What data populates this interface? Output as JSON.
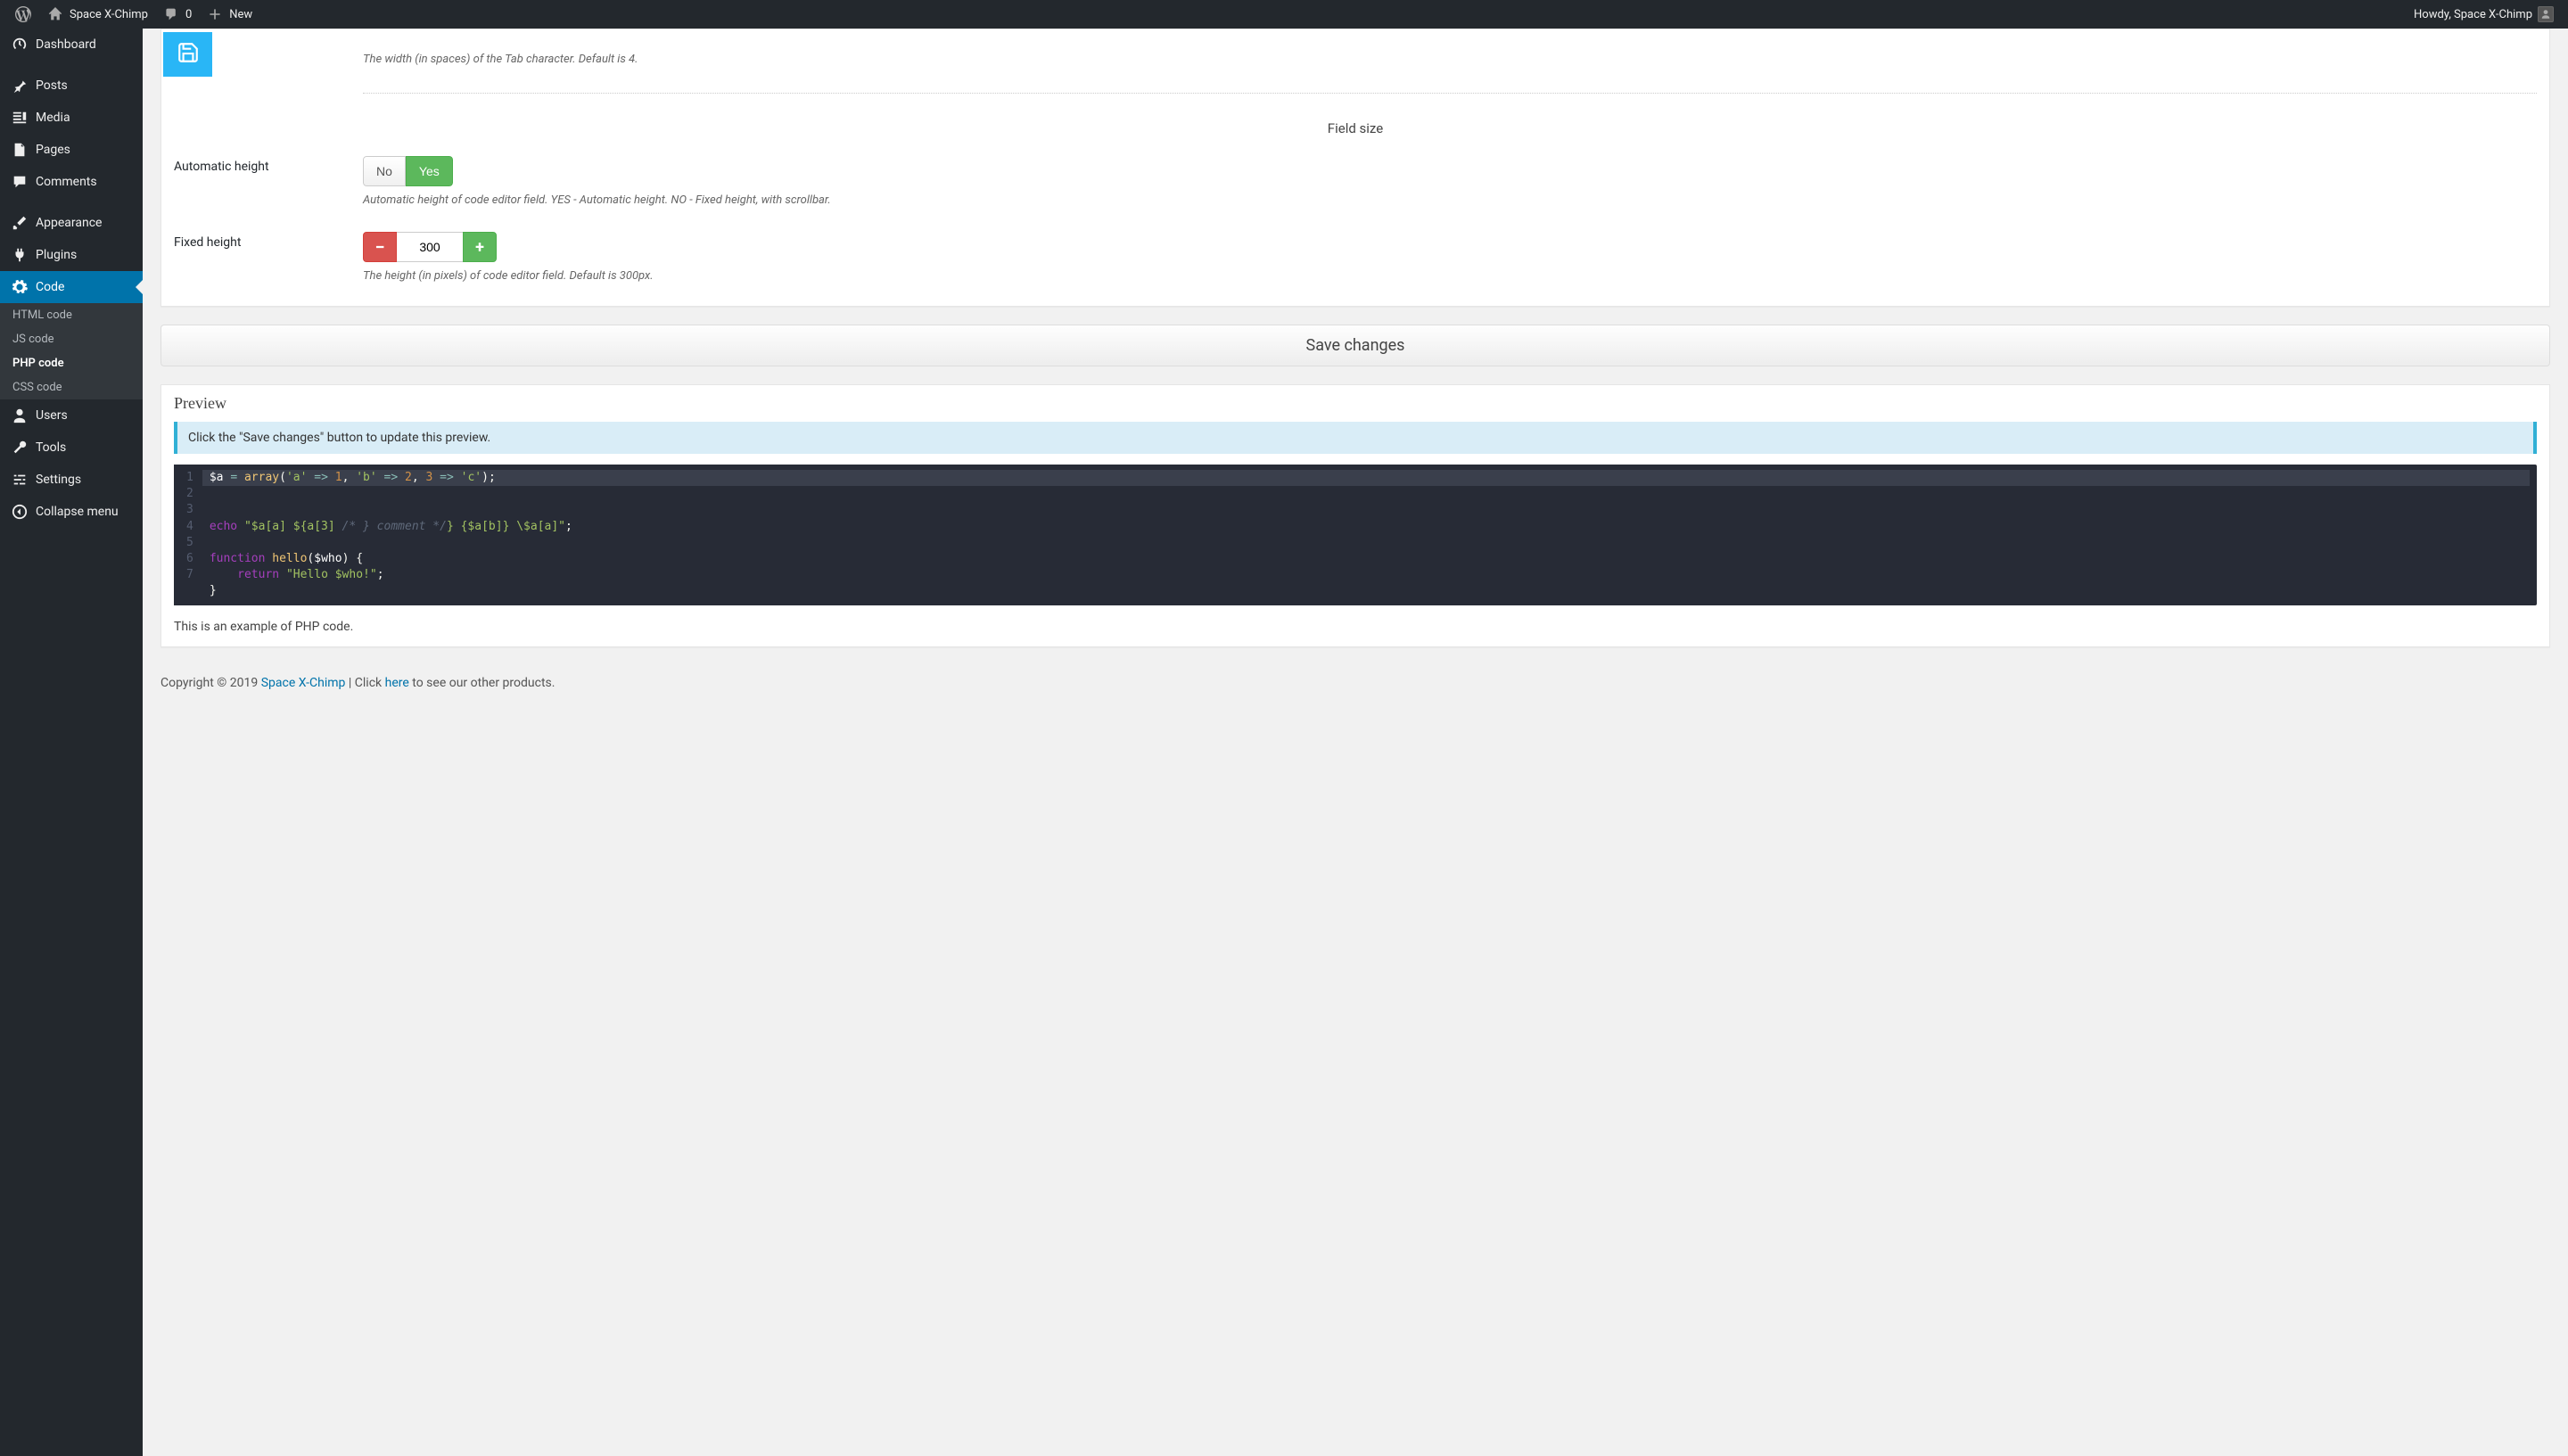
{
  "adminBar": {
    "siteName": "Space X-Chimp",
    "commentCount": "0",
    "newLabel": "New",
    "howdy": "Howdy, Space X-Chimp"
  },
  "sidebar": {
    "dashboard": "Dashboard",
    "posts": "Posts",
    "media": "Media",
    "pages": "Pages",
    "comments": "Comments",
    "appearance": "Appearance",
    "plugins": "Plugins",
    "code": "Code",
    "codeSub": {
      "html": "HTML code",
      "js": "JS code",
      "php": "PHP code",
      "css": "CSS code"
    },
    "users": "Users",
    "tools": "Tools",
    "settings": "Settings",
    "collapse": "Collapse menu"
  },
  "settings": {
    "tabWidthHelp": "The width (in spaces) of the Tab character. Default is 4.",
    "fieldSizeTitle": "Field size",
    "autoHeightLabel": "Automatic height",
    "autoHeightNo": "No",
    "autoHeightYes": "Yes",
    "autoHeightHelp": "Automatic height of code editor field. YES - Automatic height. NO - Fixed height, with scrollbar.",
    "fixedHeightLabel": "Fixed height",
    "fixedHeightValue": "300",
    "fixedHeightHelp": "The height (in pixels) of code editor field. Default is 300px.",
    "saveChanges": "Save changes"
  },
  "preview": {
    "title": "Preview",
    "note": "Click the \"Save changes\" button to update this preview.",
    "lineNumbers": [
      "1",
      "2",
      "3",
      "4",
      "5",
      "6",
      "7"
    ],
    "footnote": "This is an example of PHP code."
  },
  "footer": {
    "prefix": "Copyright © 2019 ",
    "brand": "Space X-Chimp",
    "mid": " | Click ",
    "here": "here",
    "suffix": " to see our other products."
  }
}
